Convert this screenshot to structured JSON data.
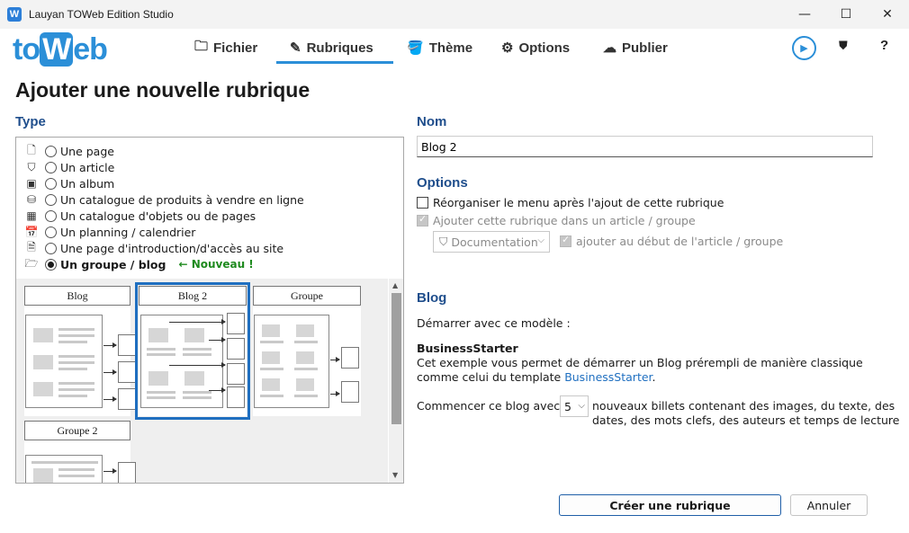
{
  "window": {
    "title": "Lauyan TOWeb Edition Studio",
    "app_icon": "W",
    "controls": {
      "minimize": "—",
      "maximize": "☐",
      "close": "✕"
    }
  },
  "toolbar": {
    "logo_pre": "to",
    "logo_w": "W",
    "logo_post": "eb",
    "tabs": [
      {
        "label": "Fichier",
        "icon": "folder-icon",
        "glyph": "🗀"
      },
      {
        "label": "Rubriques",
        "icon": "pencil-icon",
        "glyph": "✎"
      },
      {
        "label": "Thème",
        "icon": "paint-bucket-icon",
        "glyph": "🪣"
      },
      {
        "label": "Options",
        "icon": "gears-icon",
        "glyph": "⚙"
      },
      {
        "label": "Publier",
        "icon": "cloud-upload-icon",
        "glyph": "☁"
      }
    ],
    "active_tab": "Rubriques",
    "accent": "#2b8fd8",
    "play_glyph": "▶",
    "shield_glyph": "⛊",
    "help_label": "?"
  },
  "page": {
    "title": "Ajouter une nouvelle rubrique"
  },
  "type_section": {
    "label": "Type",
    "items": [
      {
        "label": "Une page",
        "icon": "page-icon",
        "glyph": "🗋",
        "selected": false
      },
      {
        "label": "Un article",
        "icon": "sitemap-icon",
        "glyph": "⛉",
        "selected": false
      },
      {
        "label": "Un album",
        "icon": "album-icon",
        "glyph": "▣",
        "selected": false
      },
      {
        "label": "Un catalogue de produits à vendre en ligne",
        "icon": "coins-icon",
        "glyph": "⛁",
        "selected": false
      },
      {
        "label": "Un catalogue d'objets ou de pages",
        "icon": "catalog-grid-icon",
        "glyph": "▦",
        "selected": false
      },
      {
        "label": "Un planning / calendrier",
        "icon": "calendar-icon",
        "glyph": "📅",
        "selected": false
      },
      {
        "label": "Une page d'introduction/d'accès au site",
        "icon": "intro-page-icon",
        "glyph": "🗎",
        "selected": false
      },
      {
        "label": "Un groupe / blog",
        "icon": "open-folder-icon",
        "glyph": "🗁",
        "selected": true
      }
    ],
    "nouveau_badge": "← Nouveau !",
    "nouveau_color": "#1e8a1e",
    "templates": [
      {
        "label": "Blog",
        "selected": false
      },
      {
        "label": "Blog 2",
        "selected": true
      },
      {
        "label": "Groupe",
        "selected": false
      },
      {
        "label": "Groupe 2",
        "selected": false
      }
    ],
    "selection_color": "#1f6fc0"
  },
  "nom_section": {
    "label": "Nom",
    "value": "Blog 2"
  },
  "options_section": {
    "label": "Options",
    "reorganize": {
      "label": "Réorganiser le menu après l'ajout de cette rubrique",
      "checked": false,
      "enabled": true
    },
    "add_to_article": {
      "label": "Ajouter cette rubrique dans un article / groupe",
      "checked": true,
      "enabled": false
    },
    "article_dropdown": {
      "value": "Documentation",
      "icon": "sitemap-icon",
      "glyph": "⛉"
    },
    "add_at_start": {
      "label": "ajouter au début de l'article / groupe",
      "checked": true,
      "enabled": false
    }
  },
  "blog_section": {
    "label": "Blog",
    "start_with_model": "Démarrer avec ce modèle :",
    "model_name": "BusinessStarter",
    "description_1": "Cet exemple vous permet de démarrer un Blog prérempli de manière classique",
    "description_2_pre": "comme celui du template ",
    "description_link": "BusinessStarter",
    "description_2_post": ".",
    "begin_label": "Commencer ce blog avec",
    "posts_count": "5",
    "posts_desc_1": "nouveaux billets contenant des images, du texte, des",
    "posts_desc_2": "dates, des mots clefs, des auteurs et temps de lecture"
  },
  "buttons": {
    "create": "Créer une rubrique",
    "cancel": "Annuler"
  }
}
